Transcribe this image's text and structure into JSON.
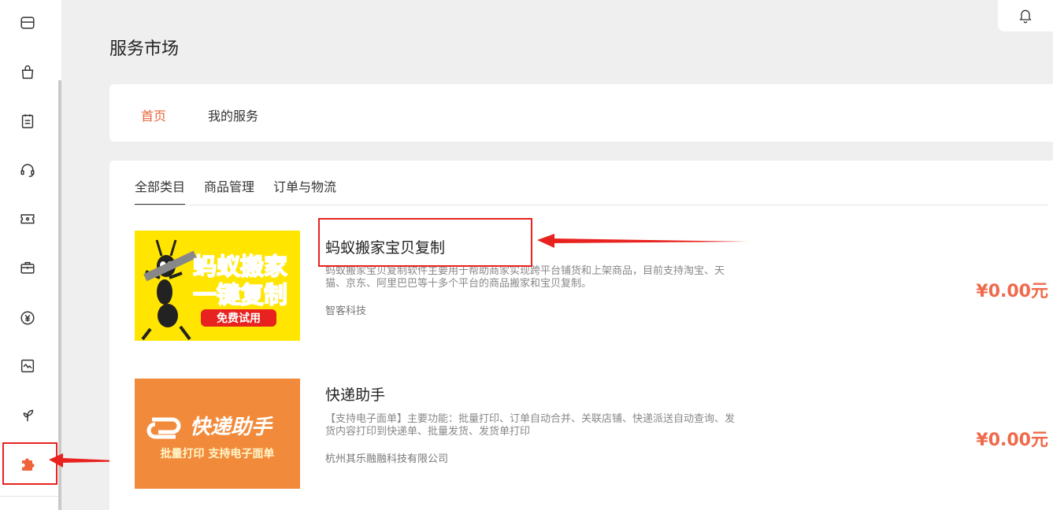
{
  "page": {
    "title": "服务市场"
  },
  "sidebar": {
    "items": [
      {
        "icon": "store-icon"
      },
      {
        "icon": "shopping-bag-icon"
      },
      {
        "icon": "order-list-icon"
      },
      {
        "icon": "headset-icon"
      },
      {
        "icon": "ticket-icon"
      },
      {
        "icon": "briefcase-icon"
      },
      {
        "icon": "yuan-icon"
      },
      {
        "icon": "chart-icon"
      },
      {
        "icon": "sprout-icon"
      },
      {
        "icon": "puzzle-icon",
        "active": true
      }
    ],
    "active_color": "#f0643c"
  },
  "nav": {
    "tabs": [
      {
        "label": "首页",
        "active": true
      },
      {
        "label": "我的服务",
        "active": false
      }
    ]
  },
  "categories": {
    "tabs": [
      {
        "label": "全部类目",
        "active": true
      },
      {
        "label": "商品管理",
        "active": false
      },
      {
        "label": "订单与物流",
        "active": false
      }
    ]
  },
  "services": [
    {
      "name": "蚂蚁搬家宝贝复制",
      "description": "蚂蚁搬家宝贝复制软件主要用于帮助商家实现跨平台铺货和上架商品，目前支持淘宝、天猫、京东、阿里巴巴等十多个平台的商品搬家和宝贝复制。",
      "vendor": "智客科技",
      "price": "¥0.00元",
      "banner": {
        "line1": "蚂蚁搬家",
        "line2": "一键复制",
        "badge": "免费试用"
      }
    },
    {
      "name": "快递助手",
      "description": "【支持电子面单】主要功能：批量打印、订单自动合并、关联店铺、快递派送自动查询、发货内容打印到快递单、批量发货、发货单打印",
      "vendor": "杭州其乐融融科技有限公司",
      "price": "¥0.00元",
      "banner": {
        "title": "快递助手",
        "subtitle": "批量打印 支持电子面单"
      }
    }
  ],
  "colors": {
    "accent": "#e8653a",
    "price": "#ef6a4c",
    "annotation": "#e8231f"
  }
}
